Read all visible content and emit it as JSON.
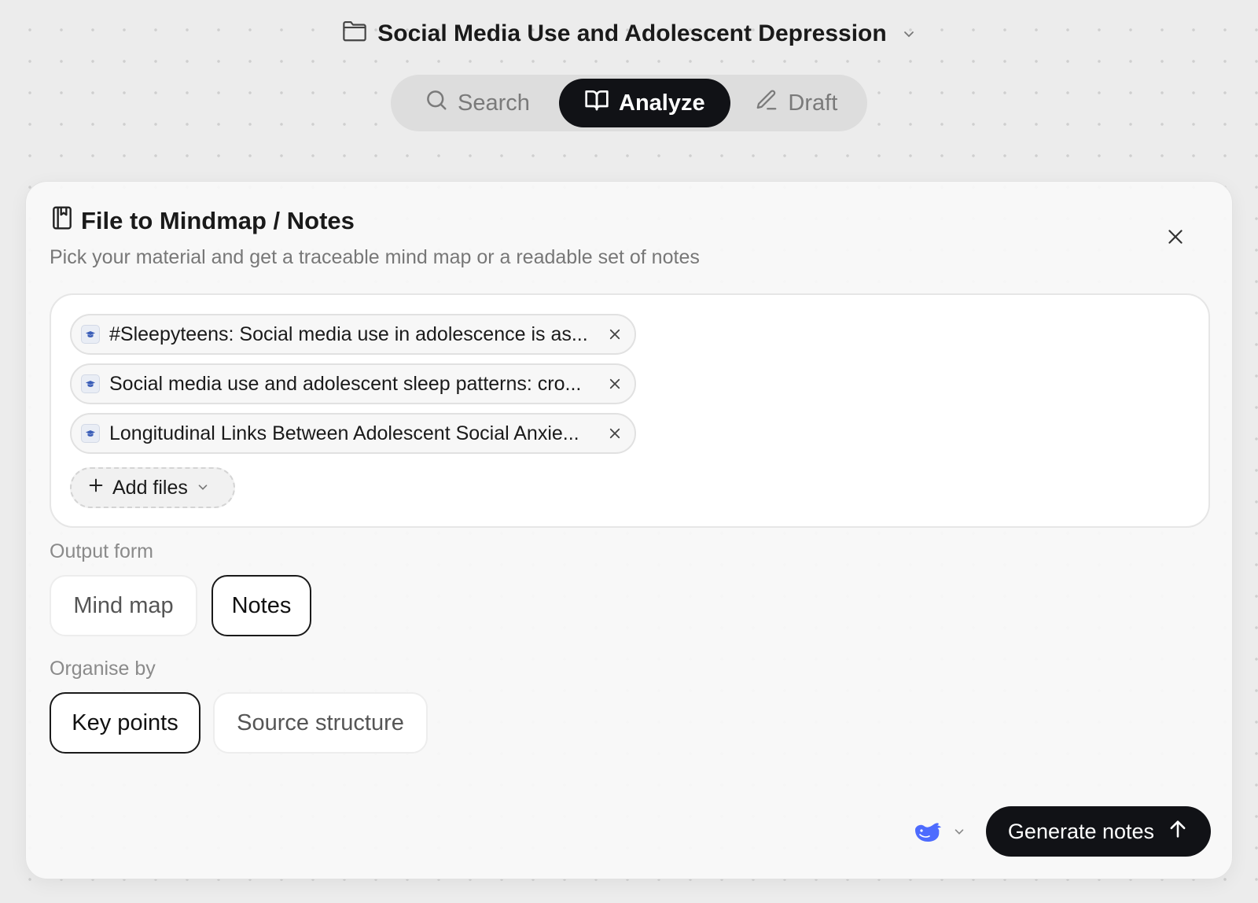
{
  "header": {
    "project_title": "Social Media Use and Adolescent Depression",
    "tabs": [
      {
        "label": "Search",
        "icon": "search-icon"
      },
      {
        "label": "Analyze",
        "icon": "book-icon",
        "active": true
      },
      {
        "label": "Draft",
        "icon": "pencil-icon"
      }
    ]
  },
  "panel": {
    "title": "File to Mindmap / Notes",
    "subtitle": "Pick your material and get a traceable mind map or a readable set of notes",
    "files": [
      {
        "label": "#Sleepyteens: Social media use in adolescence is as..."
      },
      {
        "label": "Social media use and adolescent sleep patterns: cro..."
      },
      {
        "label": "Longitudinal Links Between Adolescent Social Anxie..."
      }
    ],
    "add_files_label": "Add files",
    "output_form": {
      "label": "Output form",
      "options": [
        "Mind map",
        "Notes"
      ],
      "selected": "Notes"
    },
    "organise_by": {
      "label": "Organise by",
      "options": [
        "Key points",
        "Source structure"
      ],
      "selected": "Key points"
    },
    "generate_label": "Generate notes",
    "model_icon": "whale-icon"
  },
  "colors": {
    "accent_dark": "#111216",
    "model_icon_blue": "#4d6bfe"
  }
}
